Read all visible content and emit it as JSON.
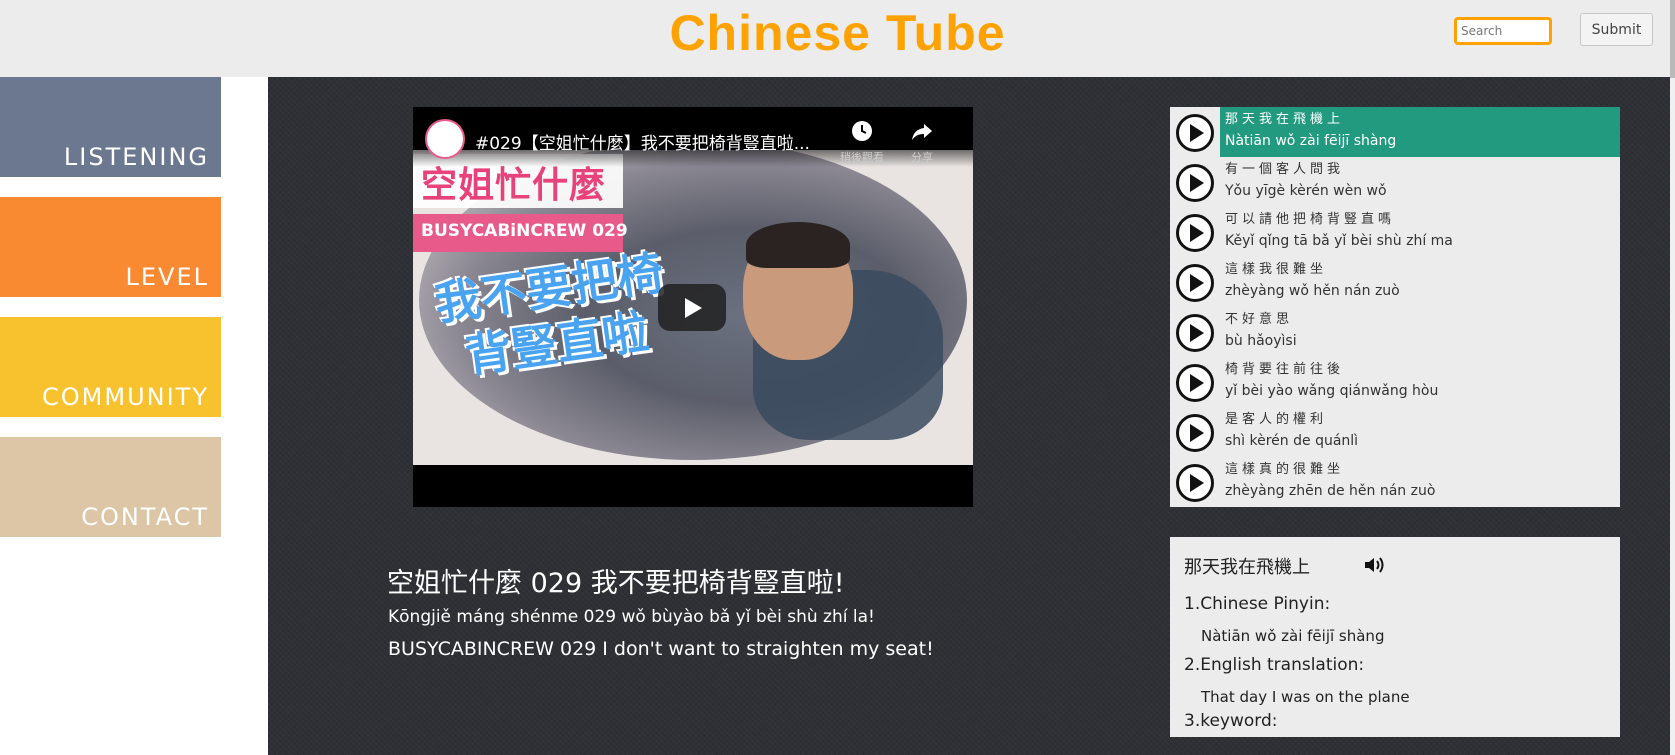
{
  "header": {
    "site_title": "Chinese Tube",
    "search_placeholder": "Search",
    "submit_label": "Submit"
  },
  "nav": {
    "items": [
      {
        "label": "LISTENING"
      },
      {
        "label": "LEVEL"
      },
      {
        "label": "COMMUNITY"
      },
      {
        "label": "CONTACT"
      }
    ]
  },
  "video": {
    "player_title": "#029【空姐忙什麼】我不要把椅背豎直啦...",
    "watch_later_label": "稍後觀看",
    "share_label": "分享",
    "thumb_title": "空姐忙什麼",
    "thumb_subtitle": "BUSYCABiNCREW 029",
    "thumb_big_text": "我不要把椅背豎直啦",
    "title": "空姐忙什麼 029 我不要把椅背豎直啦!",
    "pinyin": "Kōngjiě máng shénme 029 wǒ bùyào bǎ yǐ bèi shù zhí la!",
    "english": "BUSYCABINCREW 029 I don't want to straighten my seat!"
  },
  "sentences": [
    {
      "hanzi": "那天我在飛機上",
      "pinyin": "Nàtiān wǒ zài fēijī shàng",
      "active": true
    },
    {
      "hanzi": "有一個客人問我",
      "pinyin": "Yǒu yīgè kèrén wèn wǒ",
      "active": false
    },
    {
      "hanzi": "可以請他把椅背豎直嗎",
      "pinyin": "Kěyǐ qǐng tā bǎ yǐ bèi shù zhí ma",
      "active": false
    },
    {
      "hanzi": "這樣我很難坐",
      "pinyin": "zhèyàng wǒ hěn nán zuò",
      "active": false
    },
    {
      "hanzi": "不好意思",
      "pinyin": "bù hǎoyìsi",
      "active": false
    },
    {
      "hanzi": "椅背要往前往後",
      "pinyin": "yǐ bèi yào wǎng qiánwǎng hòu",
      "active": false
    },
    {
      "hanzi": "是客人的權利",
      "pinyin": "shì kèrén de quánlì",
      "active": false
    },
    {
      "hanzi": "這樣真的很難坐",
      "pinyin": "zhèyàng zhēn de hěn nán zuò",
      "active": false
    }
  ],
  "detail": {
    "heading": "那天我在飛機上",
    "pinyin_label": "1.Chinese Pinyin:",
    "pinyin_value": "Nàtiān wǒ zài fēijī shàng",
    "english_label": "2.English translation:",
    "english_value": "That day I was on the plane",
    "keyword_label": "3.keyword:"
  },
  "colors": {
    "brand": "#ffa200",
    "active_sentence": "#229a7f",
    "nav_listening": "#6c7890",
    "nav_level": "#fa8a32",
    "nav_community": "#f8c22f",
    "nav_contact": "#dcc6a6"
  }
}
